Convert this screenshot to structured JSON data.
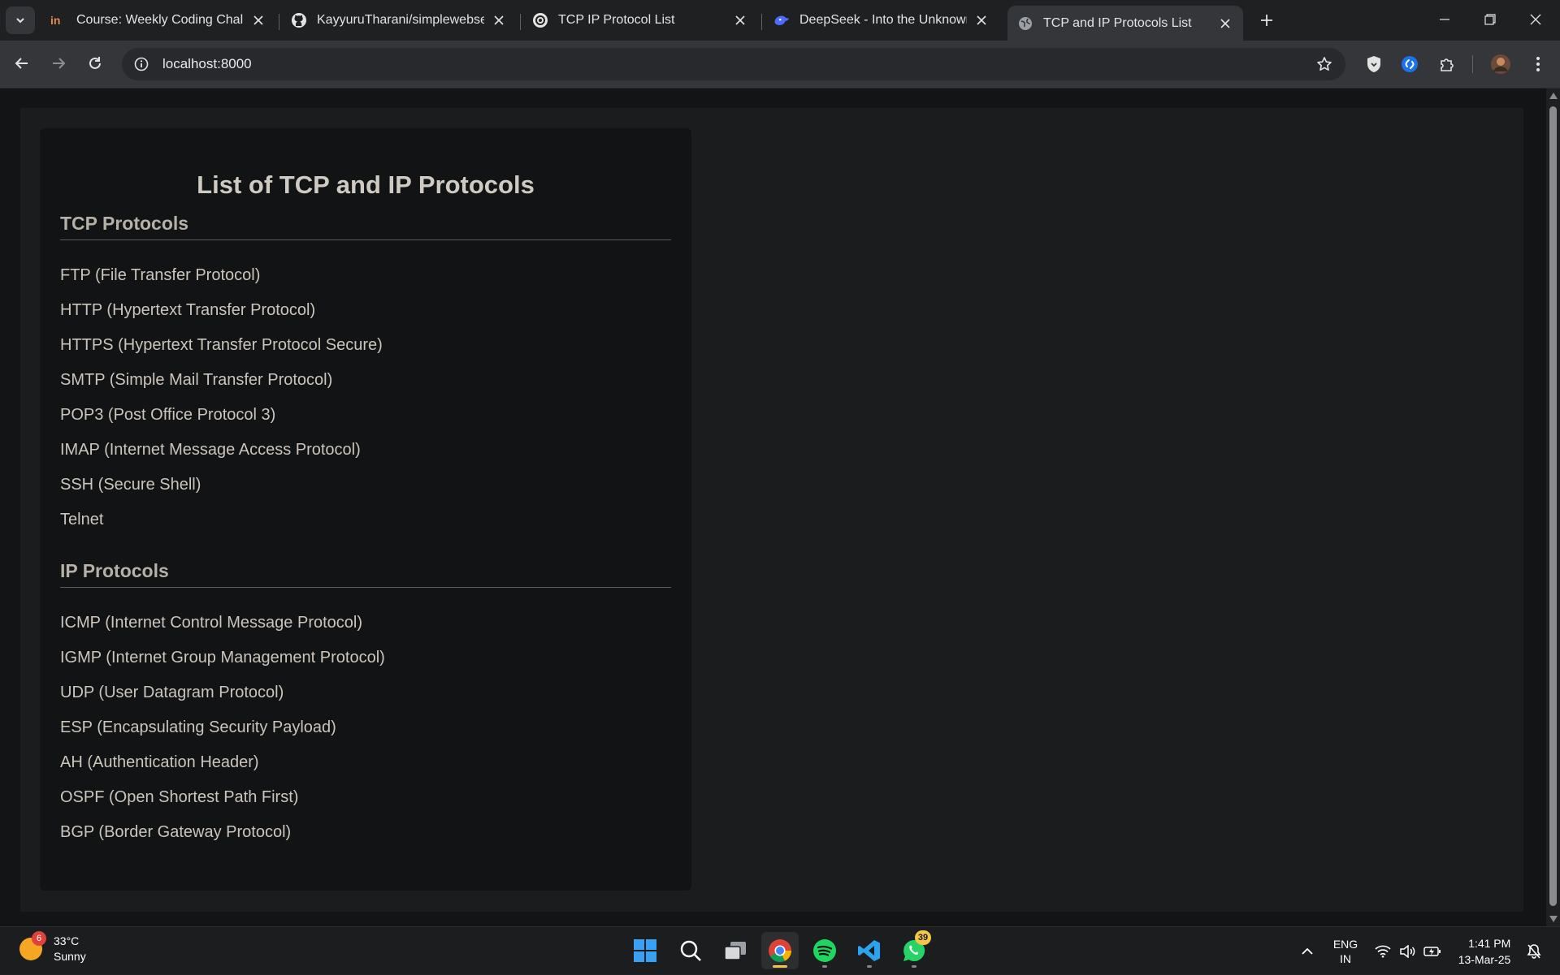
{
  "browser": {
    "tabs": [
      {
        "title": "Course: Weekly Coding Challen",
        "favicon": "course-icon",
        "active": false
      },
      {
        "title": "KayyuruTharani/simplewebserv",
        "favicon": "github-icon",
        "active": false
      },
      {
        "title": "TCP IP Protocol List",
        "favicon": "chatgpt-icon",
        "active": false
      },
      {
        "title": "DeepSeek - Into the Unknown",
        "favicon": "deepseek-icon",
        "active": false
      },
      {
        "title": "TCP and IP Protocols List",
        "favicon": "globe-icon",
        "active": true
      }
    ],
    "url": "localhost:8000"
  },
  "page": {
    "title": "List of TCP and IP Protocols",
    "tcp_heading": "TCP Protocols",
    "tcp_protocols": [
      "FTP (File Transfer Protocol)",
      "HTTP (Hypertext Transfer Protocol)",
      "HTTPS (Hypertext Transfer Protocol Secure)",
      "SMTP (Simple Mail Transfer Protocol)",
      "POP3 (Post Office Protocol 3)",
      "IMAP (Internet Message Access Protocol)",
      "SSH (Secure Shell)",
      "Telnet"
    ],
    "ip_heading": "IP Protocols",
    "ip_protocols": [
      "ICMP (Internet Control Message Protocol)",
      "IGMP (Internet Group Management Protocol)",
      "UDP (User Datagram Protocol)",
      "ESP (Encapsulating Security Payload)",
      "AH (Authentication Header)",
      "OSPF (Open Shortest Path First)",
      "BGP (Border Gateway Protocol)"
    ]
  },
  "taskbar": {
    "weather": {
      "badge": "6",
      "temp": "33°C",
      "condition": "Sunny"
    },
    "whatsapp_badge": "39",
    "language": {
      "line1": "ENG",
      "line2": "IN"
    },
    "clock": {
      "time": "1:41 PM",
      "date": "13-Mar-25"
    }
  }
}
